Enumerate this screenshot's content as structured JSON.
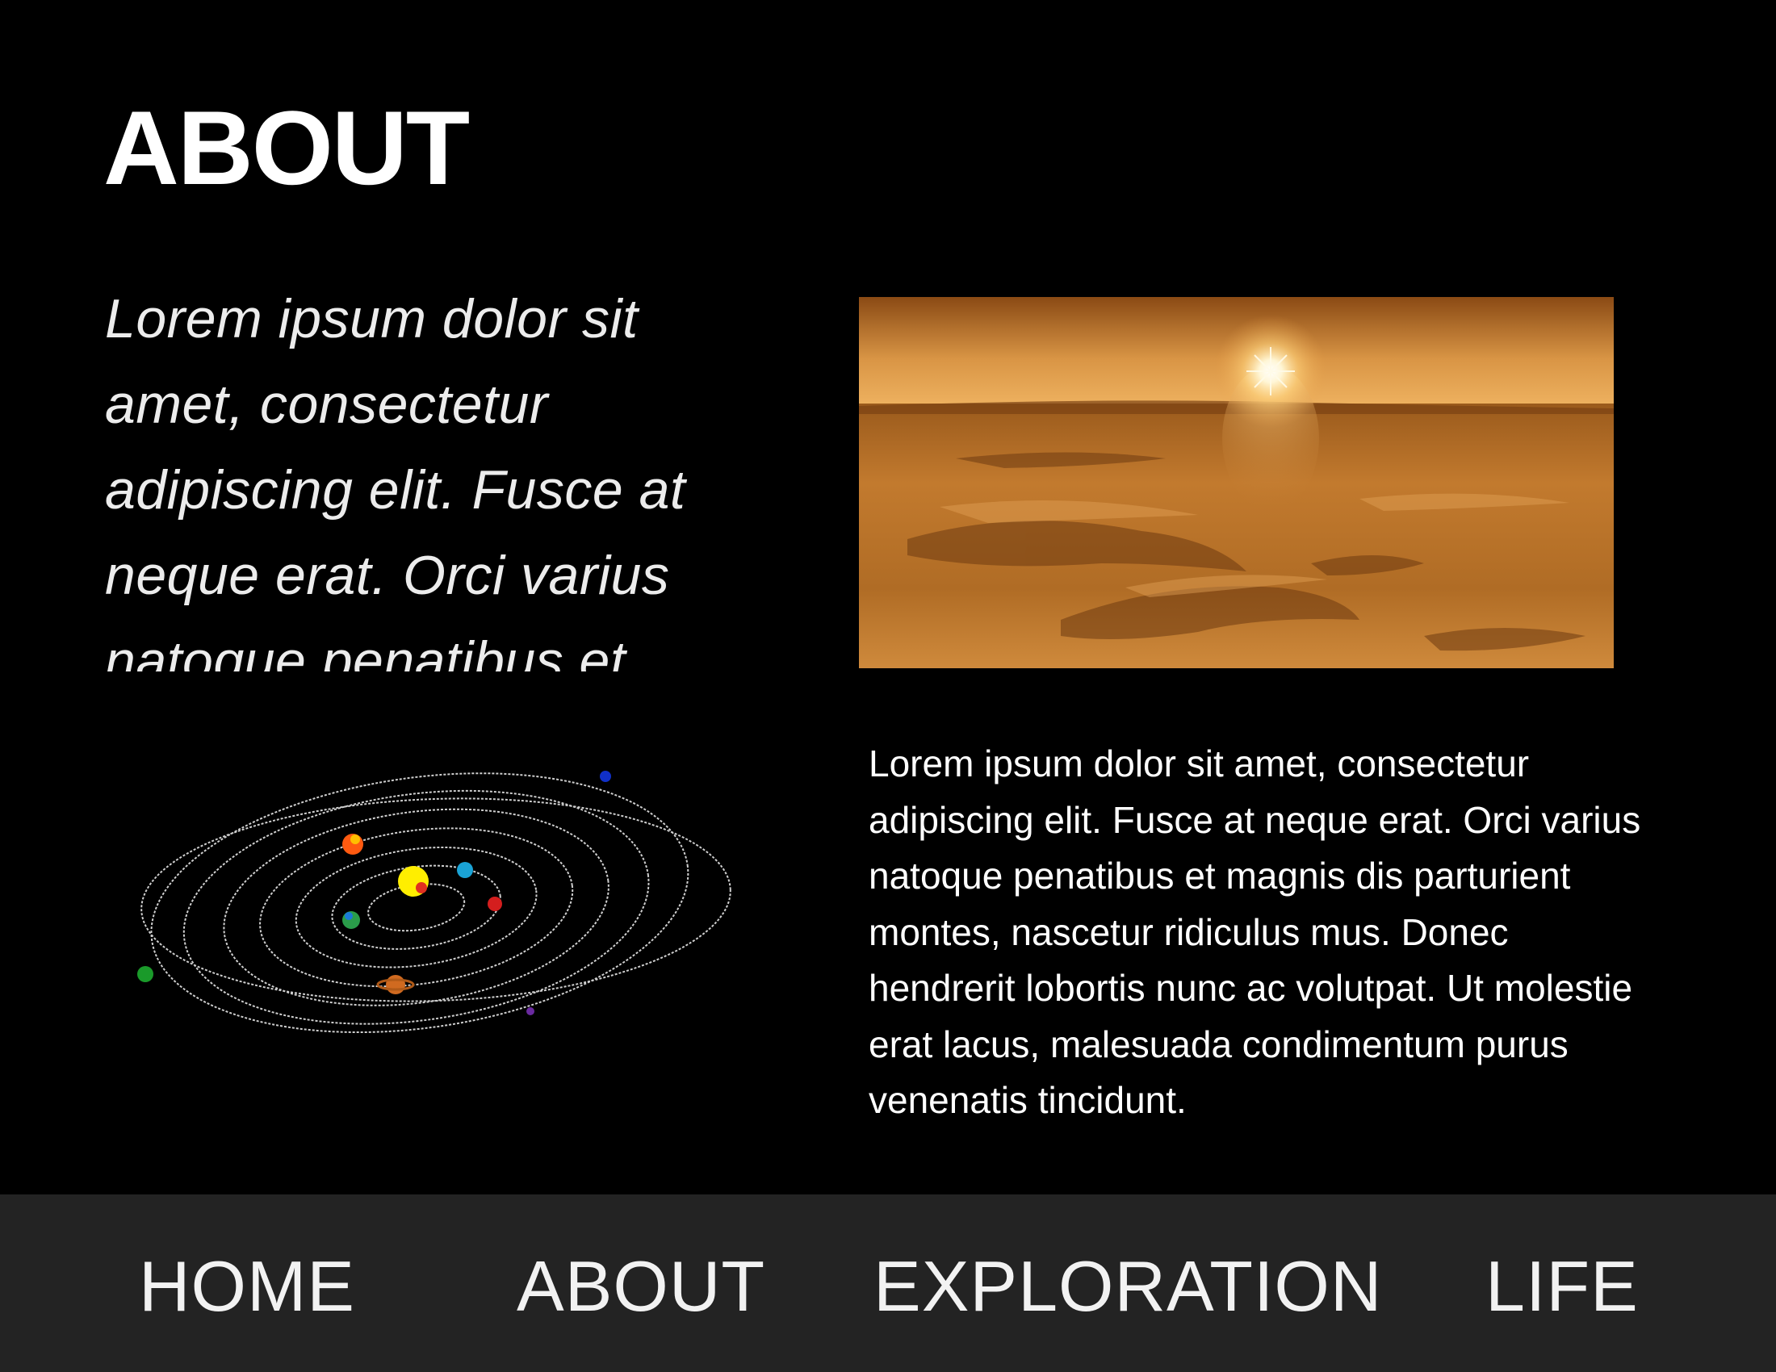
{
  "page": {
    "title": "ABOUT",
    "intro_text": "Lorem ipsum dolor sit amet, consectetur adipiscing elit. Fusce at neque erat. Orci varius natoque penatibus et",
    "body_text": "Lorem ipsum dolor sit amet, consectetur adipiscing elit. Fusce at neque erat. Orci varius natoque penatibus et magnis dis parturient montes, nascetur ridiculus mus. Donec hendrerit lobortis nunc ac volutpat. Ut molestie erat lacus, malesuada condimentum purus venenatis tincidunt."
  },
  "images": {
    "hero": "mars-desert-sunset-photo",
    "diagram": "solar-system-orbits-illustration"
  },
  "nav": {
    "items": [
      {
        "label": "HOME"
      },
      {
        "label": "ABOUT"
      },
      {
        "label": "EXPLORATION"
      },
      {
        "label": "LIFE"
      }
    ]
  },
  "colors": {
    "background": "#000000",
    "navbar": "#232323",
    "text": "#ffffff"
  }
}
